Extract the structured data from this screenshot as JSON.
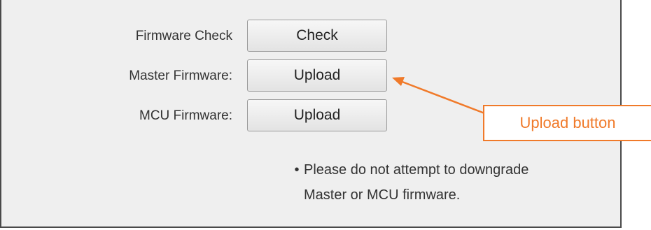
{
  "firmware": {
    "rows": [
      {
        "label": "Firmware Check",
        "button": "Check"
      },
      {
        "label": "Master Firmware:",
        "button": "Upload"
      },
      {
        "label": "MCU Firmware:",
        "button": "Upload"
      }
    ],
    "note_bullet": "•",
    "note_line1": "Please do not attempt to downgrade",
    "note_line2": "Master or MCU firmware."
  },
  "annotation": {
    "callout_text": "Upload button",
    "color": "#f07a2a"
  }
}
